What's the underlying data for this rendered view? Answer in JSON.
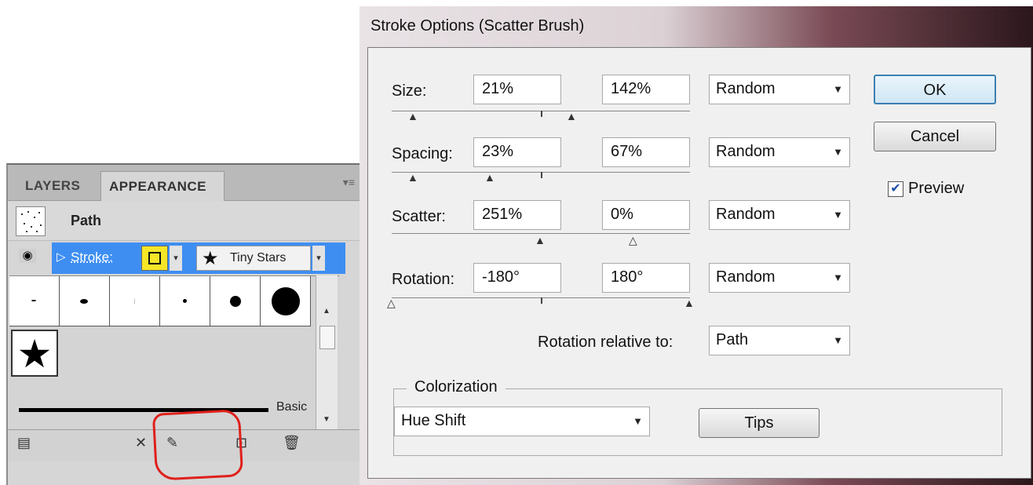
{
  "appearance_panel": {
    "tabs": [
      "LAYERS",
      "APPEARANCE"
    ],
    "path_label": "Path",
    "stroke_label": "Stroke:",
    "brush_name": "Tiny Stars",
    "basic_brush_label": "Basic"
  },
  "dialog": {
    "title": "Stroke Options (Scatter Brush)",
    "rows": {
      "size": {
        "label": "Size:",
        "min": "21%",
        "max": "142%",
        "mode": "Random"
      },
      "spacing": {
        "label": "Spacing:",
        "min": "23%",
        "max": "67%",
        "mode": "Random"
      },
      "scatter": {
        "label": "Scatter:",
        "min": "251%",
        "max": "0%",
        "mode": "Random"
      },
      "rotation": {
        "label": "Rotation:",
        "min": "-180°",
        "max": "180°",
        "mode": "Random"
      }
    },
    "rotation_relative": {
      "label": "Rotation relative to:",
      "value": "Path"
    },
    "colorization": {
      "title": "Colorization",
      "method": "Hue Shift",
      "tips_label": "Tips"
    },
    "buttons": {
      "ok": "OK",
      "cancel": "Cancel"
    },
    "preview": {
      "label": "Preview",
      "checked": true
    }
  },
  "colors": {
    "selection_blue": "#3e8ef2",
    "stroke_swatch": "#f5e628",
    "highlight_red": "#e0201b"
  }
}
